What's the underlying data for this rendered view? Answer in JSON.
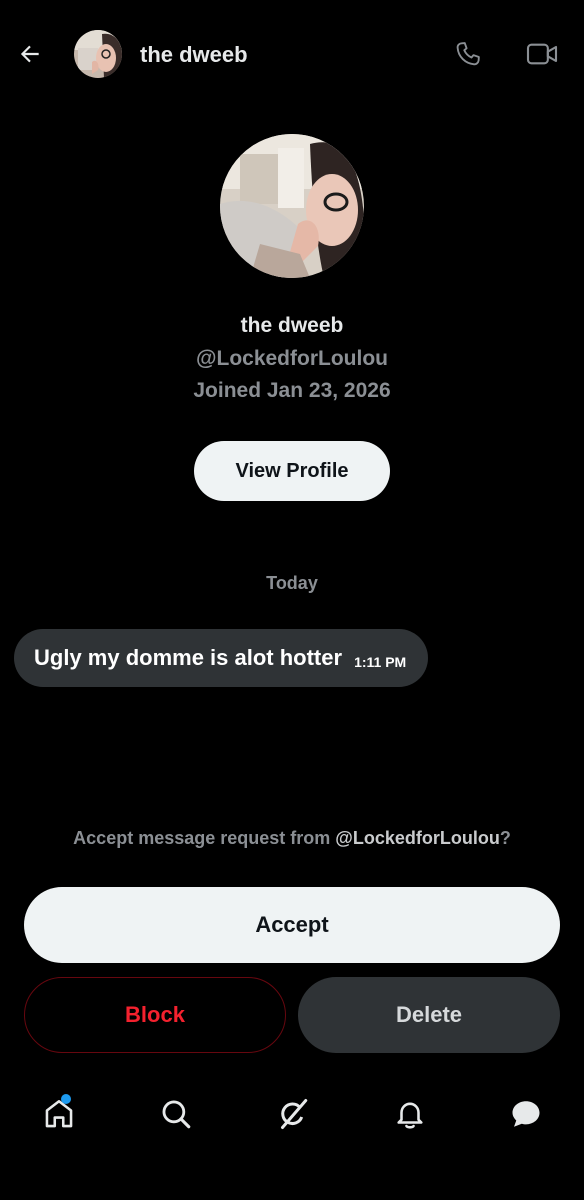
{
  "header": {
    "name": "the dweeb",
    "icons": {
      "back": "arrow-left-icon",
      "call": "phone-icon",
      "video": "video-camera-icon"
    }
  },
  "profile": {
    "name": "the dweeb",
    "handle": "@LockedforLoulou",
    "joined": "Joined Jan 23, 2026",
    "view_profile_label": "View Profile"
  },
  "conversation": {
    "date_separator": "Today",
    "messages": [
      {
        "text": "Ugly my domme is alot hotter",
        "time": "1:11 PM"
      }
    ]
  },
  "request": {
    "prefix": "Accept message request from ",
    "handle": "@LockedforLoulou",
    "suffix": "?",
    "accept_label": "Accept",
    "block_label": "Block",
    "delete_label": "Delete"
  },
  "bottom_nav": {
    "items": [
      "home-icon",
      "search-icon",
      "grok-icon",
      "notifications-bell-icon",
      "messages-icon"
    ],
    "home_has_notification_dot": true
  },
  "colors": {
    "background": "#000000",
    "primary_text": "#e7e9ea",
    "secondary_text": "#8b8f94",
    "bubble": "#2f3336",
    "block_red": "#f4212e",
    "notification_blue": "#1d9bf0",
    "light_button": "#eff3f4"
  }
}
